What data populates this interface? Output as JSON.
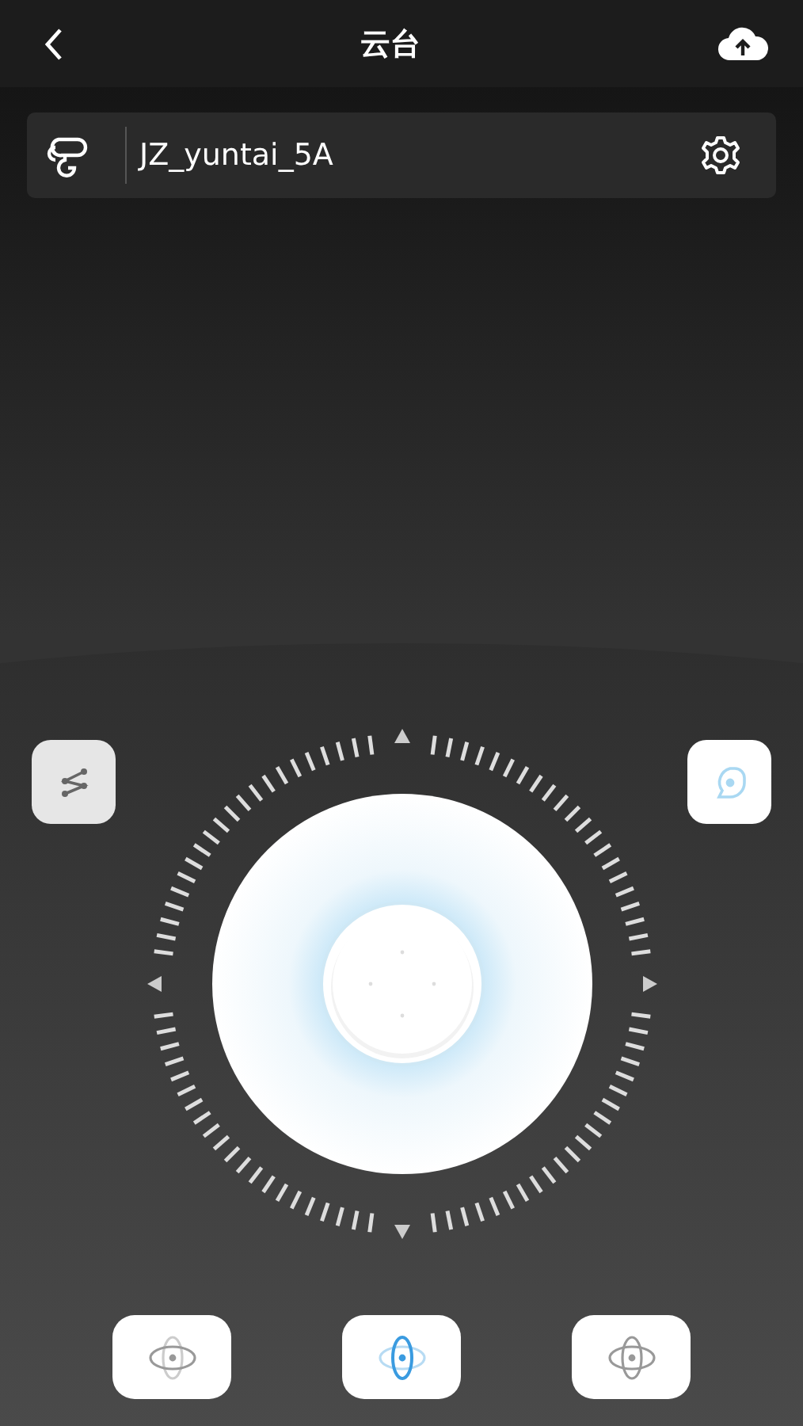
{
  "header": {
    "title": "云台"
  },
  "device": {
    "name": "JZ_yuntai_5A"
  },
  "modes": [
    {
      "kind": "pan",
      "selected": false
    },
    {
      "kind": "tilt",
      "selected": true
    },
    {
      "kind": "free",
      "selected": false
    }
  ]
}
